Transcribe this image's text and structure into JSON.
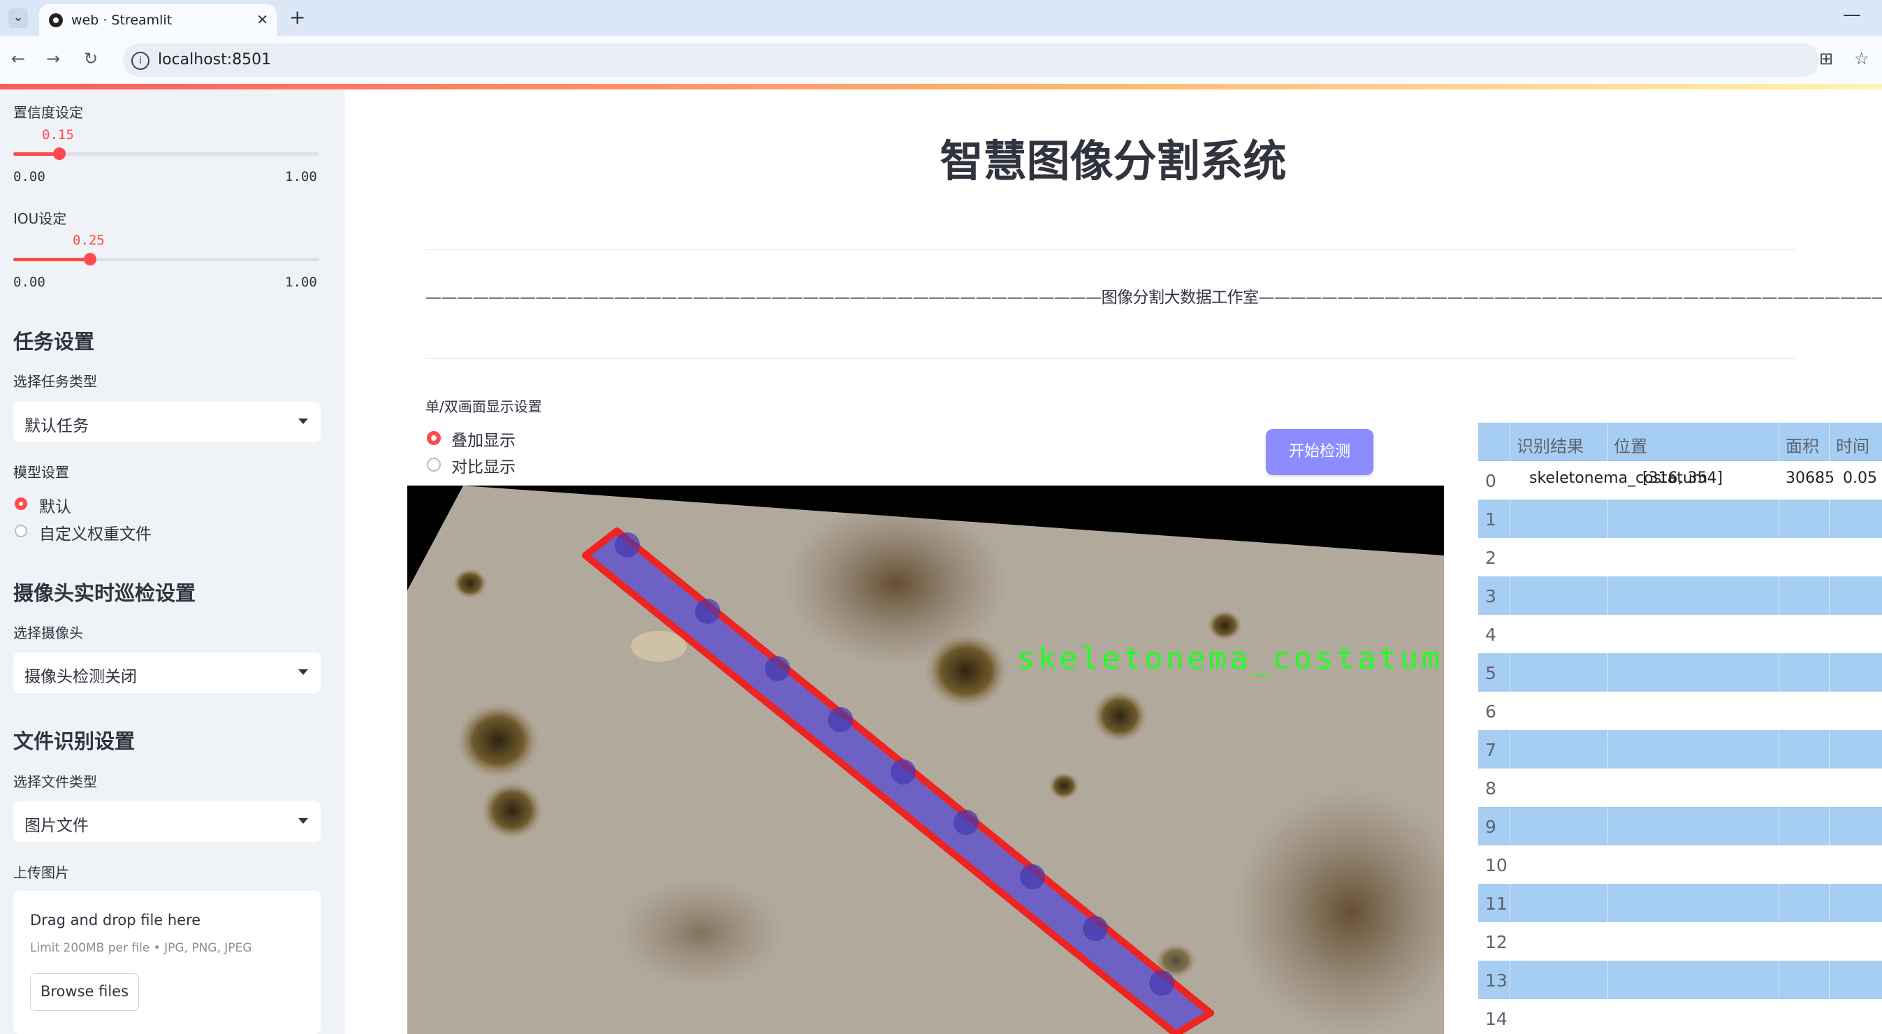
{
  "browser": {
    "tab_title": "web · Streamlit",
    "url": "localhost:8501"
  },
  "sidebar": {
    "confidence": {
      "label": "置信度设定",
      "value": "0.15",
      "min": "0.00",
      "max": "1.00",
      "fraction": 0.15
    },
    "iou": {
      "label": "IOU设定",
      "value": "0.25",
      "min": "0.00",
      "max": "1.00",
      "fraction": 0.25
    },
    "task_settings": {
      "heading": "任务设置",
      "select_label": "选择任务类型",
      "selected": "默认任务"
    },
    "model_settings": {
      "label": "模型设置",
      "options": [
        "默认",
        "自定义权重文件"
      ],
      "selected_index": 0
    },
    "camera": {
      "heading": "摄像头实时巡检设置",
      "select_label": "选择摄像头",
      "selected": "摄像头检测关闭"
    },
    "file": {
      "heading": "文件识别设置",
      "select_label": "选择文件类型",
      "selected": "图片文件"
    },
    "upload": {
      "label": "上传图片",
      "drop_text": "Drag and drop file here",
      "limit_text": "Limit 200MB per file • JPG, PNG, JPEG",
      "browse_button": "Browse files"
    }
  },
  "main": {
    "title": "智慧图像分割系统",
    "divider_text": "———————————————————————————————————————————图像分割大数据工作室———————————————————————————————————————————",
    "display_setting": {
      "label": "单/双画面显示设置",
      "options": [
        "叠加显示",
        "对比显示"
      ],
      "selected_index": 0
    },
    "start_button": "开始检测",
    "detection_overlay_label": "skeletonema_costatum"
  },
  "results_table": {
    "columns": [
      "识别结果",
      "位置",
      "面积",
      "时间"
    ],
    "rows": [
      {
        "index": "0",
        "result": "skeletonema_costatum",
        "position": "[316, 354]",
        "area": "30685",
        "time": "0.05"
      },
      {
        "index": "1"
      },
      {
        "index": "2"
      },
      {
        "index": "3"
      },
      {
        "index": "4"
      },
      {
        "index": "5"
      },
      {
        "index": "6"
      },
      {
        "index": "7"
      },
      {
        "index": "8"
      },
      {
        "index": "9"
      },
      {
        "index": "10"
      },
      {
        "index": "11"
      },
      {
        "index": "12"
      },
      {
        "index": "13"
      },
      {
        "index": "14"
      }
    ]
  },
  "colors": {
    "accent": "#ff4b4b",
    "button": "#8c8cff",
    "table_band": "#a6cdf2",
    "sidebar_bg": "#eff2f6",
    "overlay_text": "#22ff22",
    "mask_outline": "#ff0000",
    "mask_fill": "#5a4fcf"
  }
}
